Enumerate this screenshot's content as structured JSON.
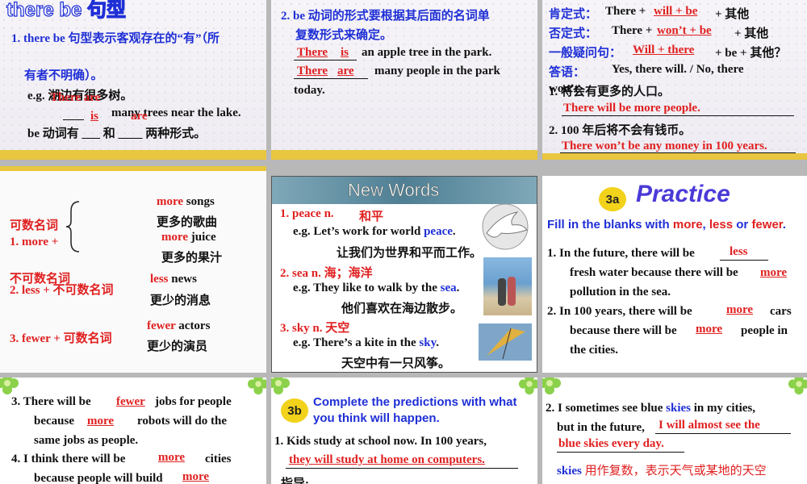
{
  "s1": {
    "title": "there be 句型",
    "rule": "1. there be  句型表示客观存在的“有”（所",
    "rule2": "有者不明确）。",
    "eg_label": "e.g.  湖边有很多树。",
    "ans_there_are": "There are",
    "ans_is": "is",
    "ans_are": "are",
    "line2_rest": "many trees near the lake.",
    "be_line": "be  动词有 ___ 和 ____  两种形式。"
  },
  "s2": {
    "rule1": "2. be  动词的形式要根据其后面的名词单",
    "rule1b": "复数形式来确定。",
    "a1": "There",
    "a2": "is",
    "l1": "an apple tree in the park.",
    "a3": "There",
    "a4": "are",
    "l2": "many people in the park",
    "l2b": "today."
  },
  "s3": {
    "k1": "肯定式：",
    "v1a": "There +",
    "v1ans": "will + be",
    "v1b": "+  其他",
    "k2": "否定式：",
    "v2a": "There +",
    "v2ans": "won’t + be",
    "v2b": "+  其他",
    "k3": "一般疑问句：",
    "v3ans": "Will + there",
    "v3b": "+ be +  其他？",
    "k4": "答语：",
    "v4": "Yes, there will. / No, there",
    "v4b": "won’t.",
    "q1": "1.  将会有更多的人口。",
    "a1": "There will be more people.",
    "q2": "2. 100 年后将不会有钱币。",
    "a2": "There won’t be any money in 100 years."
  },
  "s4": {
    "count_label": "可数名词",
    "more_label": "1. more +",
    "more_songs_1": "more",
    "more_songs_2": " songs",
    "more_songs_cn": "更多的歌曲",
    "more_juice_1": "more",
    "more_juice_2": " juice",
    "more_juice_cn": "更多的果汁",
    "uncount_label": "不可数名词",
    "less_label": "2. less +  不可数名词",
    "less_news_1": "less",
    "less_news_2": " news",
    "less_news_cn": "更少的消息",
    "fewer_label": "3. fewer +  可数名词",
    "fewer_actors_1": "fewer",
    "fewer_actors_2": " actors",
    "fewer_actors_cn": "更少的演员"
  },
  "s5": {
    "header": "New Words",
    "w1": "1. peace  n.",
    "w1cn": "和平",
    "e1a": "e.g. Let’s work for world ",
    "e1w": "peace",
    "e1b": ".",
    "e1cn": "让我们为世界和平而工作。",
    "w2": "2. sea  n.  海；海洋",
    "e2a": "e.g. They like to walk by the ",
    "e2w": "sea",
    "e2b": ".",
    "e2cn": "他们喜欢在海边散步。",
    "w3": "3. sky  n.  天空",
    "e3a": "e.g. There’s a kite in the ",
    "e3w": "sky",
    "e3b": ".",
    "e3cn": "天空中有一只风筝。"
  },
  "s6": {
    "badge": "3a",
    "header": "Practice",
    "instr_a": "Fill in the blanks with ",
    "instr_more": "more",
    "instr_c1": ", ",
    "instr_less": "less",
    "instr_or": " or ",
    "instr_fewer": "fewer",
    "instr_end": ".",
    "i1a": "1.   In the future, there will be",
    "i1ans": "less",
    "i1b": "fresh water because there will be",
    "i1ans2": "more",
    "i1c": "pollution in the sea.",
    "i2a": "2.   In 100 years, there will be",
    "i2ans": "more",
    "i2a2": "cars",
    "i2b": "because there will be",
    "i2ans2": "more",
    "i2b2": "people in",
    "i2c": "the cities."
  },
  "s7": {
    "i3a": "3.   There will be",
    "i3ans": "fewer",
    "i3b": "jobs for people",
    "i3c": "because",
    "i3ans2": "more",
    "i3d": "robots will do the",
    "i3e": "same jobs as people.",
    "i4a": "4.   I think there will be",
    "i4ans": "more",
    "i4b": "cities",
    "i4c": "because people will build",
    "i4ans2": "more"
  },
  "s8": {
    "badge": "3b",
    "instr": "Complete the predictions with what",
    "instr2": "you think will happen.",
    "q1": "1. Kids study at school now. In 100 years,",
    "a1": "they will study at home on computers.",
    "hint": "指导:"
  },
  "s9": {
    "q2a": "2. I sometimes see blue ",
    "q2w": "skies",
    "q2b": " in my cities,",
    "q2c": "but in the future,",
    "a2": "I will almost see the",
    "a2b": "blue skies every day.",
    "note_w": "skies",
    "note": " 用作复数，表示天气或某地的天空"
  },
  "colors": {
    "blue": "#1f2fd6",
    "red": "#e02020",
    "band": "#e8c63f",
    "green": "#7cc43a"
  }
}
